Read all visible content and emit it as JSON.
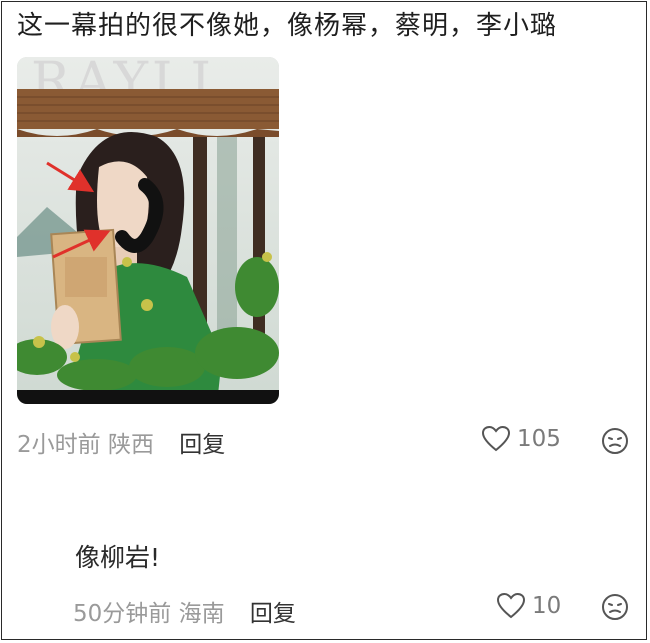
{
  "comment": {
    "text": "这一幕拍的很不像她，像杨幂，蔡明，李小璐",
    "photo_magazine_letters": "RAYLI",
    "time": "2小时前",
    "location": "陕西",
    "reply_label": "回复",
    "likes": "105"
  },
  "reply": {
    "text": "像柳岩!",
    "time": "50分钟前",
    "location": "海南",
    "reply_label": "回复",
    "likes": "10"
  },
  "colors": {
    "meta_gray": "#9a9a9a",
    "arrow_red": "#e0312b",
    "dress_green": "#2e8a3e"
  },
  "icons": [
    "heart-icon",
    "sad-face-icon"
  ]
}
